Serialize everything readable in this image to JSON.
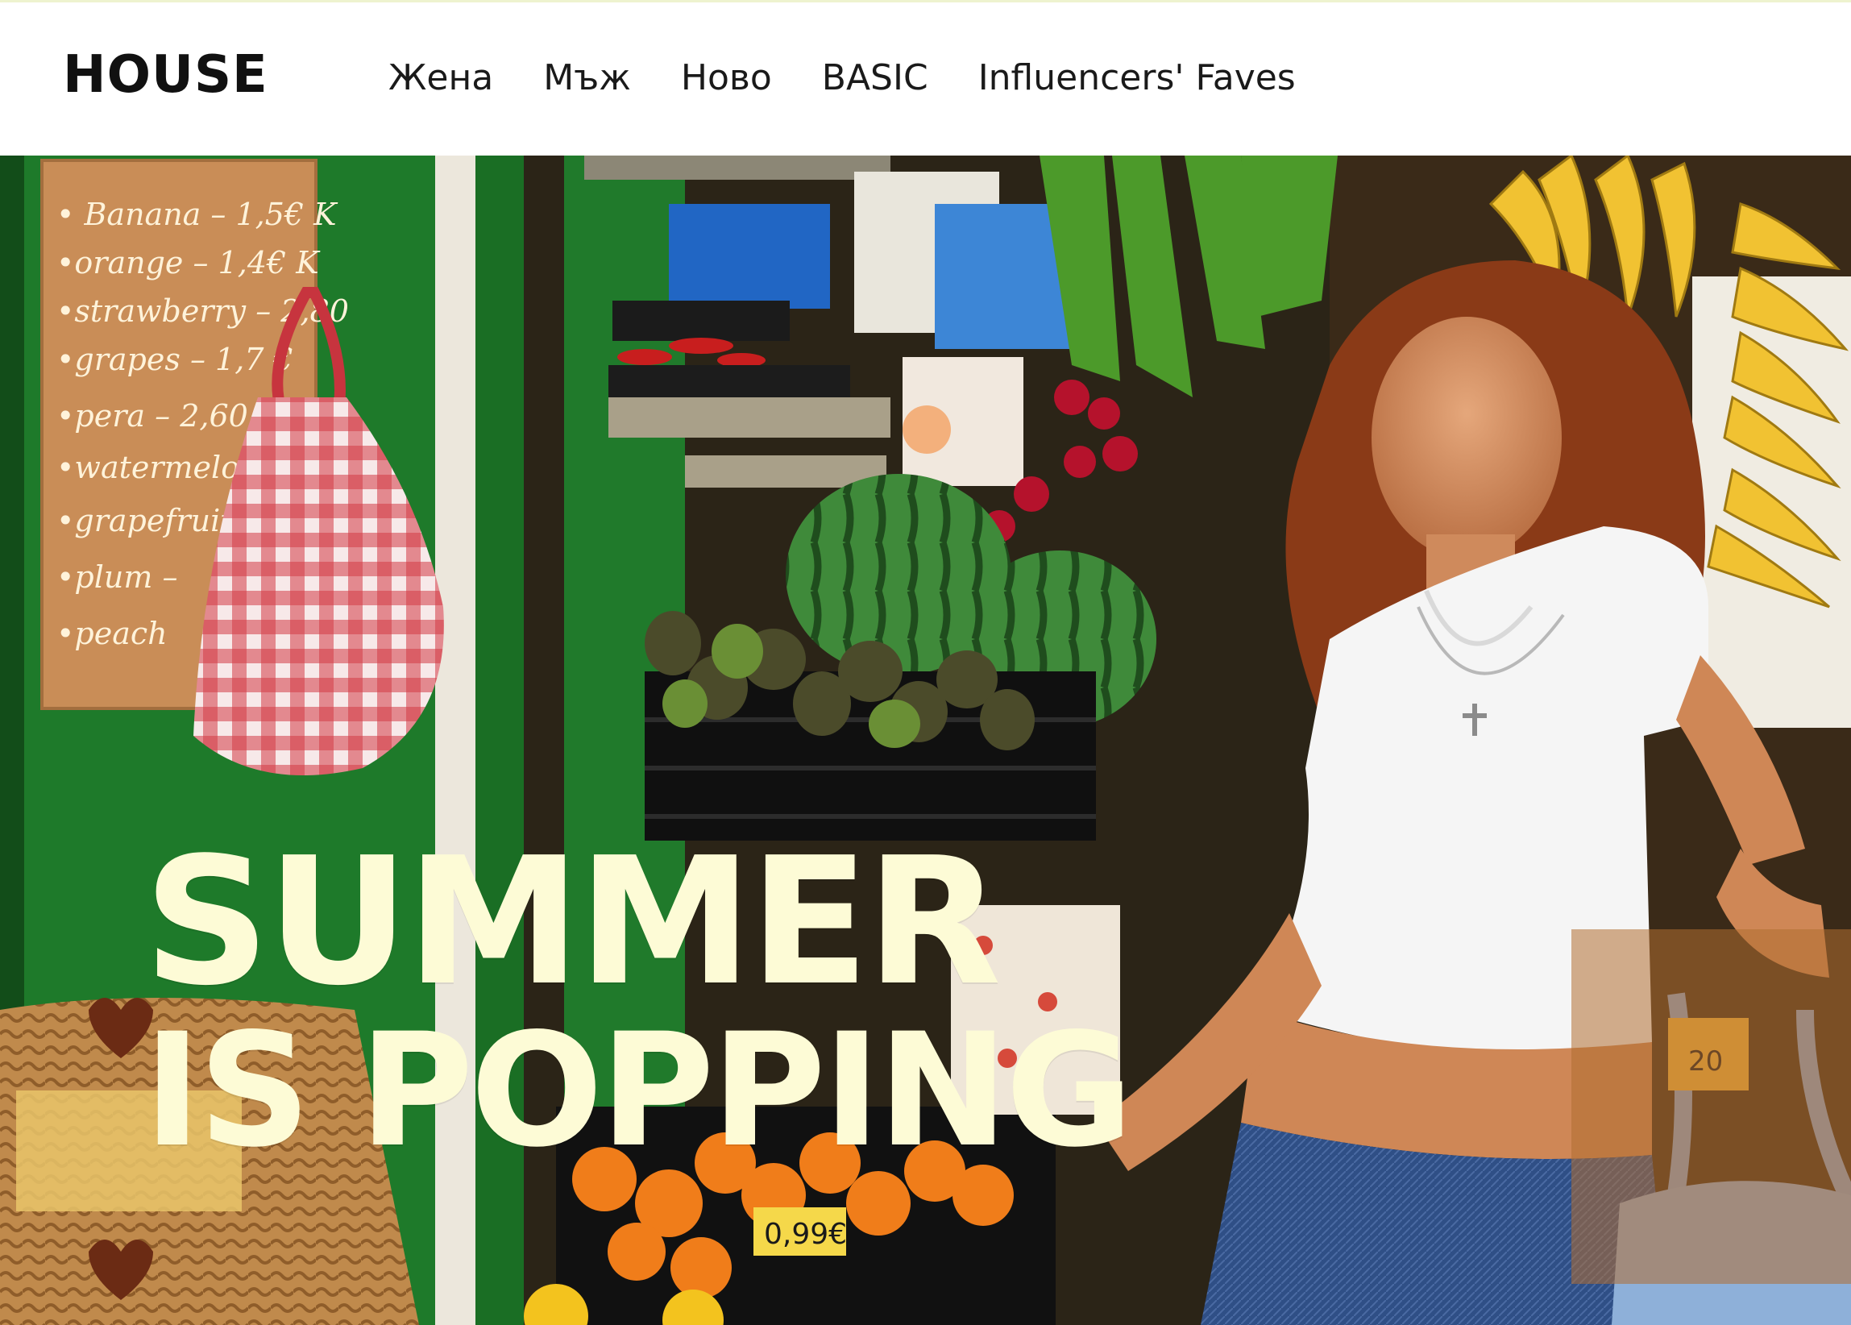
{
  "header": {
    "logo": "HOUSE",
    "nav": [
      {
        "label": "Жена"
      },
      {
        "label": "Мъж"
      },
      {
        "label": "Ново"
      },
      {
        "label": "BASIC"
      },
      {
        "label": "Influencers' Faves"
      }
    ]
  },
  "hero": {
    "headline_line1": "SUMMER",
    "headline_line2": "IS POPPING",
    "price_board": [
      "• Banana – 1,5€ K",
      "•orange – 1,4€ K",
      "•strawberry – 2,80",
      "•grapes – 1,7 €",
      "•pera – 2,60",
      "•watermelon –",
      "•grapefruit –",
      "•plum –",
      "•peach"
    ],
    "price_tag_oranges": "0,99€",
    "price_tag_bag": "20"
  },
  "colors": {
    "headline": "#fdfbd6",
    "hero_green": "#1e7a2a",
    "text": "#1a1a1a"
  }
}
